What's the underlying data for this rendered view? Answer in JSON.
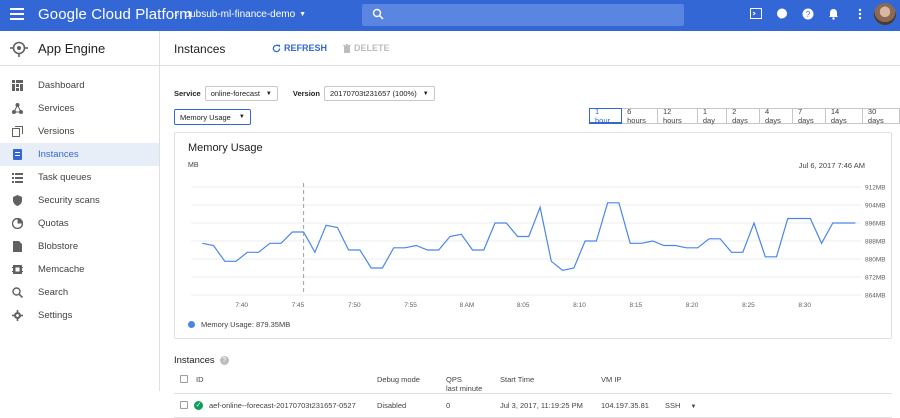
{
  "topbar": {
    "brand": "Google Cloud Platform",
    "project": "pubsub-ml-finance-demo",
    "icons": [
      "menu-icon",
      "project-icon",
      "search-icon",
      "cloud-shell-icon",
      "chat-icon",
      "help-icon",
      "notifications-icon",
      "more-icon"
    ]
  },
  "sidebar": {
    "product": "App Engine",
    "items": [
      {
        "label": "Dashboard",
        "icon": "dashboard-icon"
      },
      {
        "label": "Services",
        "icon": "services-icon"
      },
      {
        "label": "Versions",
        "icon": "versions-icon"
      },
      {
        "label": "Instances",
        "icon": "instances-icon",
        "active": true
      },
      {
        "label": "Task queues",
        "icon": "task-queues-icon"
      },
      {
        "label": "Security scans",
        "icon": "security-icon"
      },
      {
        "label": "Quotas",
        "icon": "quotas-icon"
      },
      {
        "label": "Blobstore",
        "icon": "blobstore-icon"
      },
      {
        "label": "Memcache",
        "icon": "memcache-icon"
      },
      {
        "label": "Search",
        "icon": "search-icon"
      },
      {
        "label": "Settings",
        "icon": "settings-icon"
      }
    ]
  },
  "header": {
    "title": "Instances",
    "refresh": "REFRESH",
    "delete": "DELETE"
  },
  "filters": {
    "service_label": "Service",
    "service_value": "online-forecast",
    "version_label": "Version",
    "version_value": "20170703t231657 (100%)",
    "metric_value": "Memory Usage"
  },
  "time_ranges": [
    "1 hour",
    "6 hours",
    "12 hours",
    "1 day",
    "2 days",
    "4 days",
    "7 days",
    "14 days",
    "30 days"
  ],
  "selected_range": "1 hour",
  "chart_data": {
    "type": "line",
    "title": "Memory Usage",
    "ylabel": "MB",
    "timestamp": "Jul 6, 2017 7:46 AM",
    "ylim": [
      864,
      912
    ],
    "y_ticks": [
      "912MB",
      "904MB",
      "896MB",
      "888MB",
      "880MB",
      "872MB",
      "864MB"
    ],
    "x_ticks": [
      "7:40",
      "7:45",
      "7:50",
      "7:55",
      "8 AM",
      "8:05",
      "8:10",
      "8:15",
      "8:20",
      "8:25",
      "8:30"
    ],
    "x_minutes": [
      0,
      5,
      10,
      15,
      20,
      25,
      30,
      35,
      40,
      45,
      50
    ],
    "marker_minute": 5.5,
    "color": "#4a86e8",
    "series": [
      {
        "name": "Memory Usage",
        "x": [
          -3.5,
          -2.5,
          -1.5,
          -0.5,
          0.5,
          1.5,
          2.5,
          3.5,
          4.5,
          5.5,
          6.5,
          7.5,
          8.5,
          9.5,
          10.5,
          11.5,
          12.5,
          13.5,
          14.5,
          15.5,
          16.5,
          17.5,
          18.5,
          19.5,
          20.5,
          21.5,
          22.5,
          23.5,
          24.5,
          25.5,
          26.5,
          27.5,
          28.5,
          29.5,
          30.5,
          31.5,
          32.5,
          33.5,
          34.5,
          35.5,
          36.5,
          37.5,
          38.5,
          39.5,
          40.5,
          41.5,
          42.5,
          43.5,
          44.5,
          45.5,
          46.5,
          47.5,
          48.5,
          49.5,
          50.5,
          51.5,
          52.5,
          53.5,
          54.5
        ],
        "values": [
          887,
          886,
          879,
          879,
          883,
          883,
          887,
          887,
          892,
          892,
          883,
          895,
          894,
          884,
          884,
          876,
          876,
          885,
          885,
          886,
          884,
          884,
          890,
          891,
          884,
          884,
          896,
          896,
          890,
          890,
          903,
          879,
          875,
          876,
          888,
          888,
          905,
          905,
          887,
          887,
          888,
          886,
          886,
          885,
          885,
          889,
          889,
          883,
          883,
          896,
          881,
          881,
          898,
          898,
          898,
          887,
          896,
          896,
          896
        ]
      }
    ],
    "legend": "Memory Usage: 879.35MB"
  },
  "instances": {
    "title": "Instances",
    "columns": [
      "ID",
      "Debug mode",
      "QPS last minute",
      "Start Time",
      "VM IP"
    ],
    "qps_sub": "last minute",
    "rows": [
      {
        "id": "aef-online--forecast-20170703t231657-0527",
        "debug": "Disabled",
        "qps": "0",
        "start": "Jul 3, 2017, 11:19:25 PM",
        "ip": "104.197.35.81",
        "ssh": "SSH"
      }
    ]
  }
}
